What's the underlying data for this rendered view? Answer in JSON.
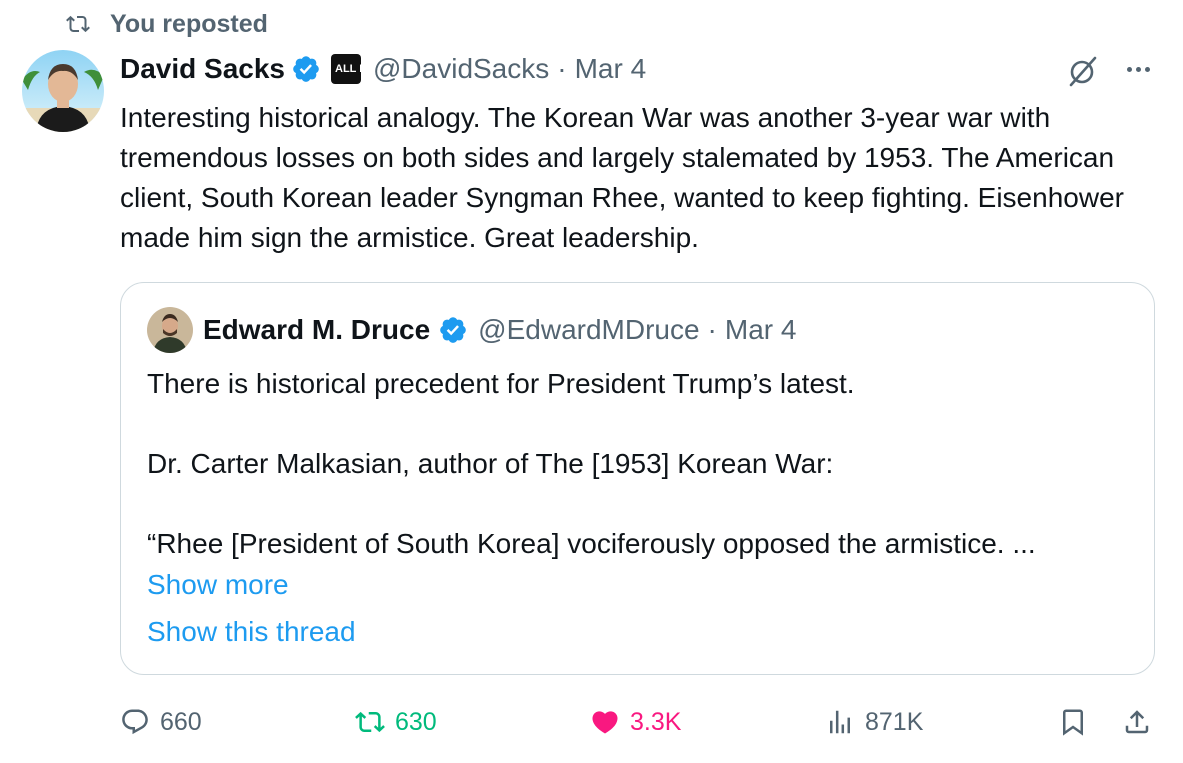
{
  "repost": {
    "label": "You reposted",
    "icon": "repost-icon"
  },
  "tweet": {
    "author_name": "David Sacks",
    "affiliate_badge_text": "ALL IN",
    "handle": "@DavidSacks",
    "separator": "·",
    "date": "Mar 4",
    "text": "Interesting historical analogy. The Korean War was another 3-year war with tremendous losses on both sides and largely stalemated by 1953. The American client, South Korean leader Syngman Rhee, wanted to keep fighting. Eisenhower made him sign the armistice. Great leadership."
  },
  "quote": {
    "author_name": "Edward M. Druce",
    "handle": "@EdwardMDruce",
    "separator": "·",
    "date": "Mar 4",
    "line1": "There is historical precedent for President Trump’s latest.",
    "line2": "Dr. Carter Malkasian, author of The [1953] Korean War:",
    "line3": "“Rhee [President of South Korea] vociferously opposed the armistice. ...",
    "show_more": "Show more",
    "show_thread": "Show this thread"
  },
  "actions": {
    "replies": "660",
    "reposts": "630",
    "likes": "3.3K",
    "views": "871K"
  },
  "colors": {
    "accent": "#1d9bf0",
    "repost_green": "#00ba7c",
    "like_pink": "#f91880",
    "muted": "#536471"
  }
}
